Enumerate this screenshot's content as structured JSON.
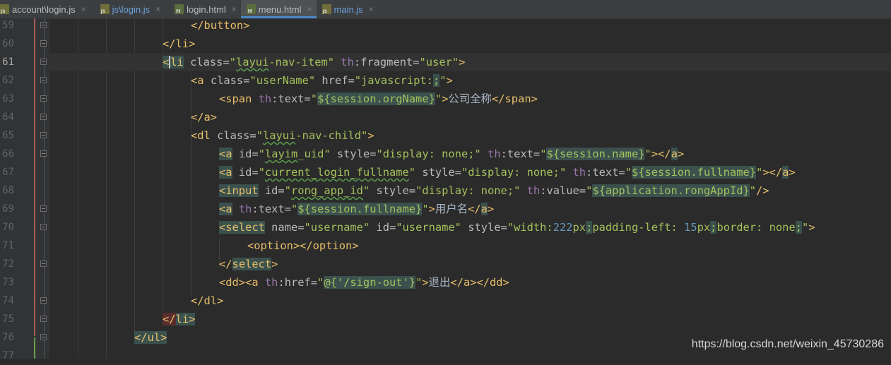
{
  "tabs": [
    {
      "label": "account\\login.js",
      "icon": "js-file-icon",
      "link": false,
      "active": false
    },
    {
      "label": "js\\login.js",
      "icon": "js-file-icon",
      "link": true,
      "active": false
    },
    {
      "label": "login.html",
      "icon": "html-file-icon",
      "link": false,
      "active": false
    },
    {
      "label": "menu.html",
      "icon": "html-file-icon",
      "link": false,
      "active": true
    },
    {
      "label": "main.js",
      "icon": "js-file-icon",
      "link": true,
      "active": false
    }
  ],
  "close_glyph": "×",
  "editor": {
    "current_line": "61",
    "line_numbers": [
      "59",
      "60",
      "61",
      "62",
      "63",
      "64",
      "65",
      "66",
      "67",
      "68",
      "69",
      "70",
      "71",
      "72",
      "73",
      "74",
      "75",
      "76",
      "77"
    ]
  },
  "watermark": "https://blog.csdn.net/weixin_45730286",
  "colors": {
    "background": "#2b2b2b",
    "tag": "#e8bf6a",
    "string": "#a5c25c",
    "namespace": "#9876aa",
    "text": "#a9b7c6",
    "active_tab_underline": "#4a88c7"
  }
}
